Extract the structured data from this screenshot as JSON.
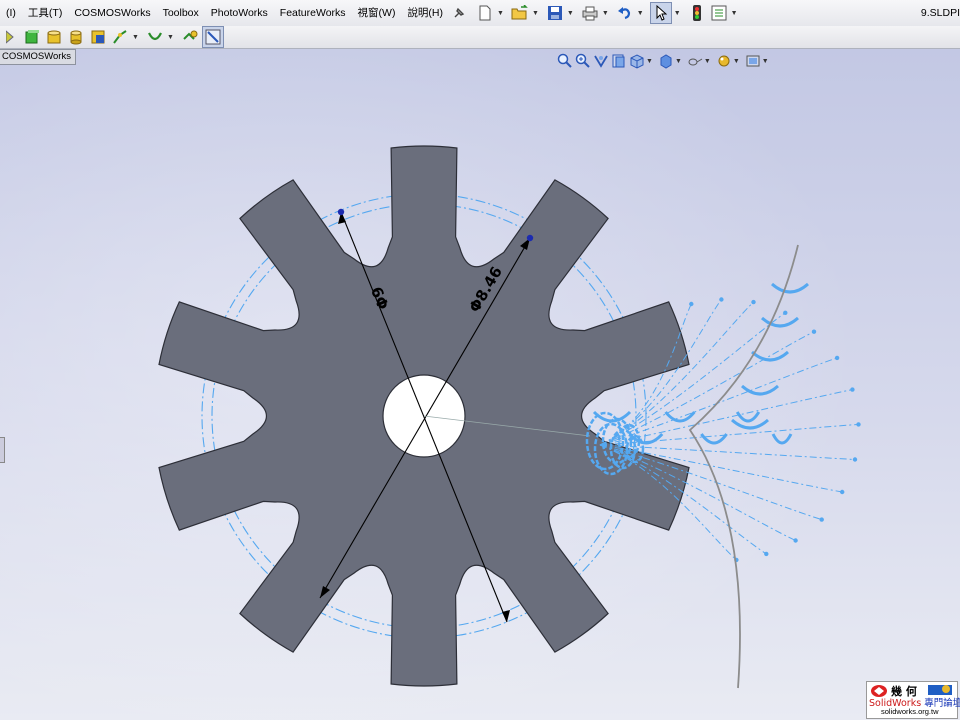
{
  "menubar": {
    "items": [
      "(I)",
      "工具(T)",
      "COSMOSWorks",
      "Toolbox",
      "PhotoWorks",
      "FeatureWorks",
      "視窗(W)",
      "說明(H)"
    ]
  },
  "window_title": "9.SLDPI",
  "tab": {
    "label": "COSMOSWorks"
  },
  "dimensions": {
    "d1": "Φ9",
    "d2": "Φ8.46"
  },
  "logo": {
    "line1": "幾 何",
    "brand": "SolidWorks",
    "line2_suffix": "專門論壇",
    "url": "solidworks.org.tw"
  },
  "colors": {
    "gear": "#6a6e7c",
    "construction": "#55a8f0",
    "bg_top": "#c8cce5",
    "bg_bottom": "#eef0f6"
  }
}
